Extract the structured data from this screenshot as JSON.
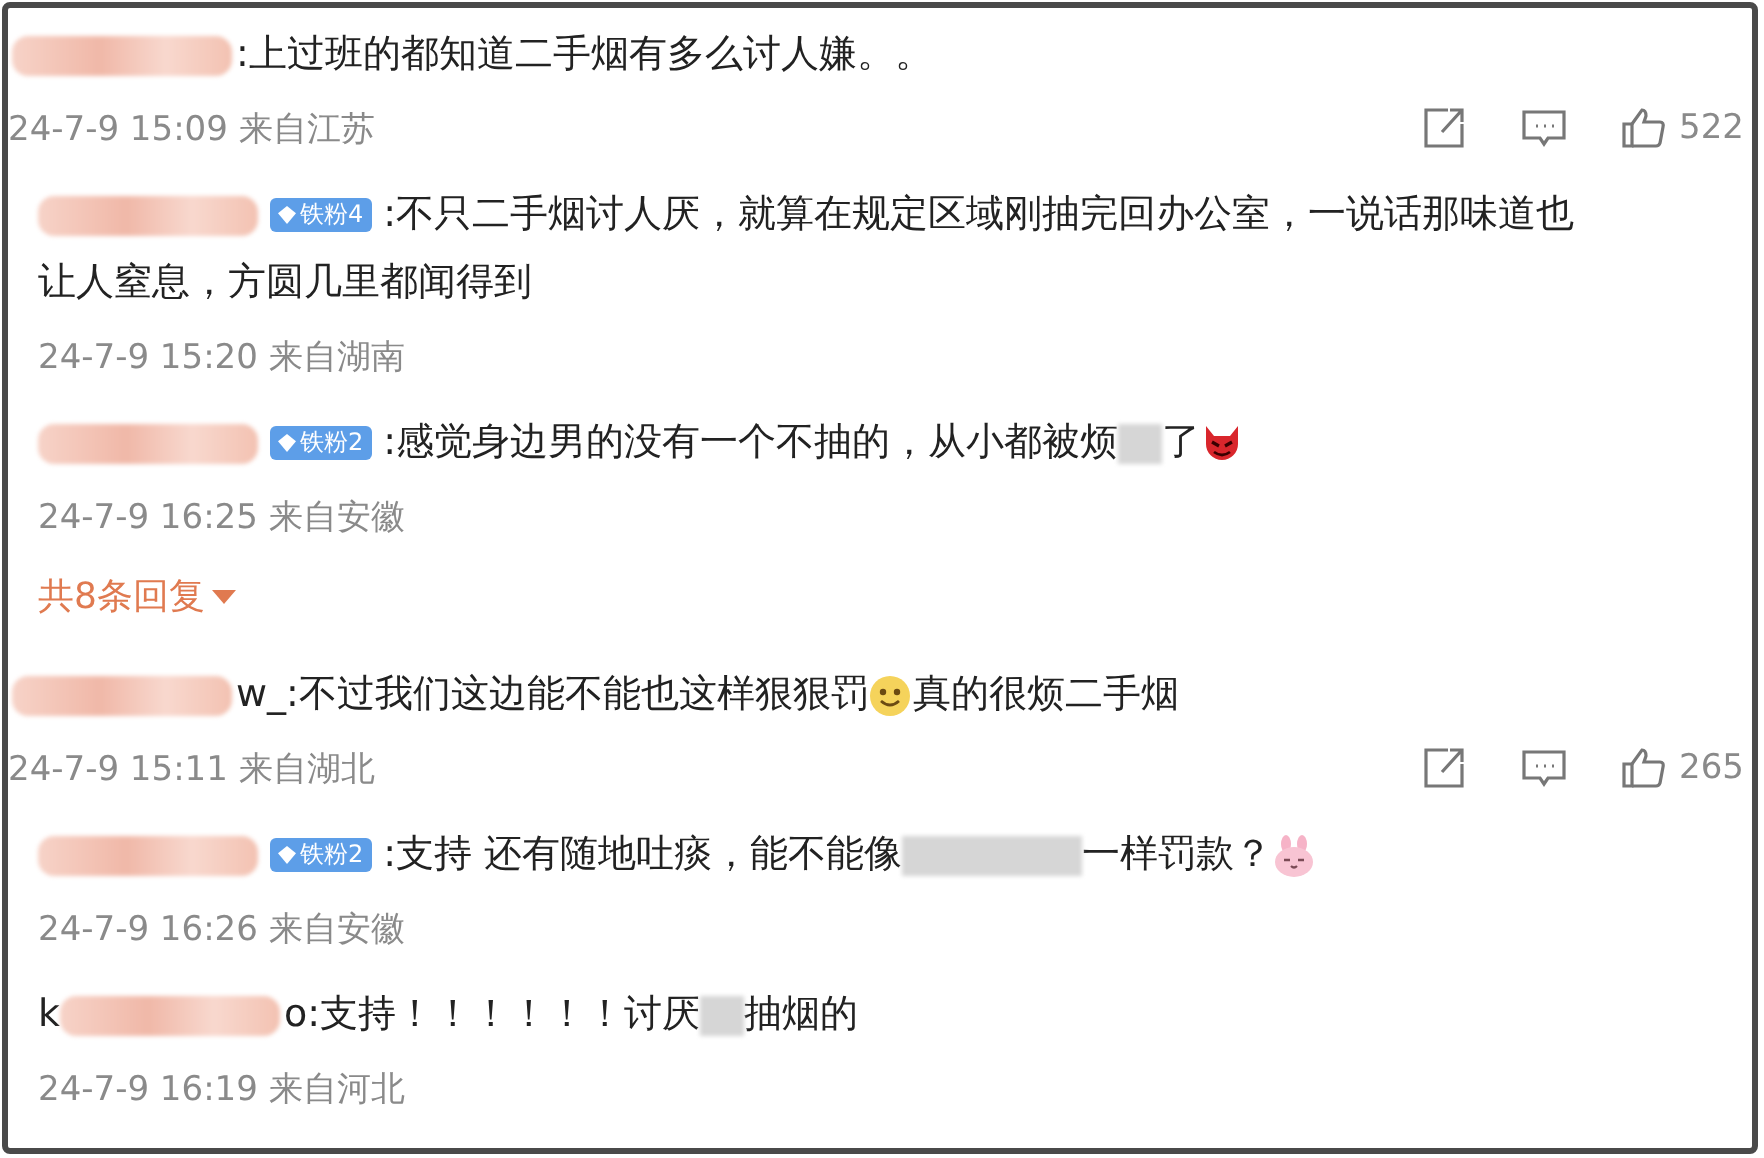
{
  "comments": [
    {
      "line": [
        {
          "kind": "name_blur"
        },
        {
          "kind": "text",
          "text": ":上过班的都知道二手烟有多么讨人嫌。。"
        }
      ],
      "meta": "24-7-9 15:09 来自江苏",
      "likes": "522",
      "replies": [
        {
          "line": [
            {
              "kind": "name_blur"
            },
            {
              "kind": "badge",
              "text": "铁粉4"
            },
            {
              "kind": "text",
              "text": ":不只二手烟讨人厌，就算在规定区域刚抽完回办公室，一说话那味道也"
            },
            {
              "kind": "continued",
              "text": "让人窒息，方圆几里都闻得到"
            }
          ],
          "meta": "24-7-9 15:20 来自湖南"
        },
        {
          "line": [
            {
              "kind": "name_blur"
            },
            {
              "kind": "badge",
              "text": "铁粉2"
            },
            {
              "kind": "text",
              "text": ":感觉身边男的没有一个不抽的，从小都被烦"
            },
            {
              "kind": "text_blur"
            },
            {
              "kind": "text",
              "text": "了"
            },
            {
              "kind": "devil"
            }
          ],
          "meta": "24-7-9 16:25 来自安徽"
        }
      ],
      "more": "共8条回复"
    },
    {
      "line": [
        {
          "kind": "name_blur"
        },
        {
          "kind": "text",
          "text": "w_"
        },
        {
          "kind": "text",
          "text": ":不过我们这边能不能也这样狠狠罚"
        },
        {
          "kind": "smiley"
        },
        {
          "kind": "text",
          "text": "真的很烦二手烟"
        }
      ],
      "meta": "24-7-9 15:11 来自湖北",
      "likes": "265",
      "replies": [
        {
          "line": [
            {
              "kind": "name_blur"
            },
            {
              "kind": "badge",
              "text": "铁粉2"
            },
            {
              "kind": "text",
              "text": ":支持 还有随地吐痰，能不能像"
            },
            {
              "kind": "long_blur"
            },
            {
              "kind": "text",
              "text": "一样罚款？"
            },
            {
              "kind": "bunny"
            }
          ],
          "meta": "24-7-9 16:26 来自安徽"
        },
        {
          "line": [
            {
              "kind": "text",
              "text": "k"
            },
            {
              "kind": "name_blur"
            },
            {
              "kind": "text",
              "text": "o"
            },
            {
              "kind": "text",
              "text": ":支持！！！！！！讨厌"
            },
            {
              "kind": "text_blur"
            },
            {
              "kind": "text",
              "text": "抽烟的"
            }
          ],
          "meta": "24-7-9 16:19 来自河北"
        }
      ]
    }
  ]
}
